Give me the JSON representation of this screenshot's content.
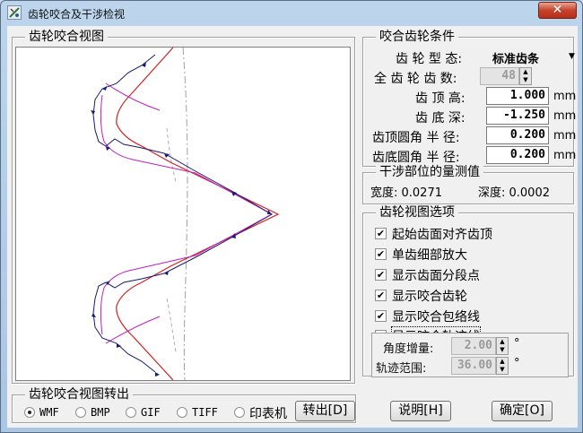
{
  "window": {
    "title": "齿轮咬合及干涉检视",
    "close_label": "✕"
  },
  "view_panel": {
    "title": "齿轮咬合视图"
  },
  "conditions": {
    "title": "咬合齿轮条件",
    "tooth_type": {
      "label": "齿 轮 型 态:",
      "value": "标准齿条"
    },
    "tooth_count": {
      "label": "全 齿 轮 齿 数:",
      "value": "48"
    },
    "addendum": {
      "label": "齿 顶 高:",
      "value": "1.000",
      "unit": "mm"
    },
    "dedendum": {
      "label": "齿 底 深:",
      "value": "-1.250",
      "unit": "mm"
    },
    "tip_radius": {
      "label": "齿顶圆角 半 径:",
      "value": "0.200",
      "unit": "mm"
    },
    "root_radius": {
      "label": "齿底圆角 半 径:",
      "value": "0.200",
      "unit": "mm"
    }
  },
  "measure": {
    "title": "干涉部位的量测值",
    "width": "宽度: 0.0271",
    "depth": "深度: 0.0002"
  },
  "options": {
    "title": "齿轮视图选项",
    "items": [
      {
        "label": "起始齿面对齐齿顶",
        "checked": "✔"
      },
      {
        "label": "单齿细部放大",
        "checked": "✔"
      },
      {
        "label": "显示齿面分段点",
        "checked": "✔"
      },
      {
        "label": "显示咬合齿轮",
        "checked": "✔"
      },
      {
        "label": "显示咬合包络线",
        "checked": "✔"
      },
      {
        "label": "显示咬合轨迹线",
        "checked": ""
      }
    ],
    "angle_step": {
      "label": "角度增量:",
      "value": "2.00",
      "unit": "°"
    },
    "track_range": {
      "label": "轨迹范围:",
      "value": "36.00",
      "unit": "°"
    }
  },
  "export": {
    "title": "齿轮咬合视图转出",
    "formats": [
      "WMF",
      "BMP",
      "GIF",
      "TIFF",
      "印表机"
    ],
    "selected": "WMF",
    "export_button": "转出[D]"
  },
  "buttons": {
    "help": "说明[H]",
    "ok": "确定[O]"
  },
  "colors": {
    "profile_red": "#d42020",
    "envelope_magenta": "#c020c0",
    "track_navy": "#1a1a70",
    "circle_gray": "#a0a0a0"
  }
}
